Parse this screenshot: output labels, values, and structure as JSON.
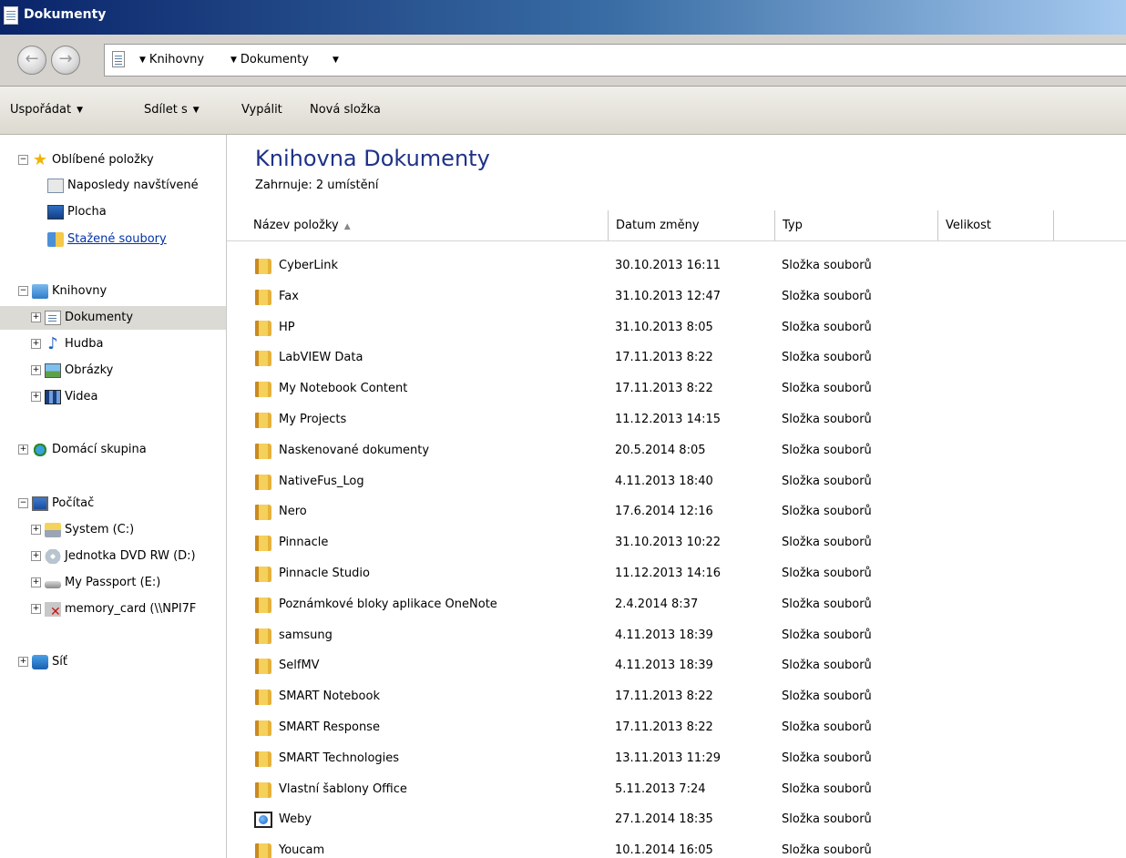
{
  "window": {
    "title": "Dokumenty"
  },
  "address": {
    "crumbs": [
      "Knihovny",
      "Dokumenty"
    ]
  },
  "toolbar": {
    "organize": "Uspořádat",
    "share": "Sdílet s",
    "burn": "Vypálit",
    "new_folder": "Nová složka"
  },
  "nav": {
    "favorites": "Oblíbené položky",
    "recent": "Naposledy navštívené",
    "desktop": "Plocha",
    "downloads": "Stažené soubory",
    "libraries": "Knihovny",
    "documents": "Dokumenty",
    "music": "Hudba",
    "pictures": "Obrázky",
    "videos": "Videa",
    "homegroup": "Domácí skupina",
    "computer": "Počítač",
    "drive_c": "System (C:)",
    "drive_d": "Jednotka DVD RW (D:)",
    "drive_e": "My Passport (E:)",
    "drive_net": "memory_card (\\\\NPI7F",
    "network": "Síť"
  },
  "main": {
    "title": "Knihovna Dokumenty",
    "includes_label": "Zahrnuje:",
    "includes_value": "2 umístění",
    "columns": [
      "Název položky",
      "Datum změny",
      "Typ",
      "Velikost"
    ],
    "rows": [
      {
        "name": "CyberLink",
        "date": "30.10.2013 16:11",
        "type": "Složka souborů",
        "icon": "folder-icon"
      },
      {
        "name": "Fax",
        "date": "31.10.2013 12:47",
        "type": "Složka souborů",
        "icon": "folder-icon"
      },
      {
        "name": "HP",
        "date": "31.10.2013 8:05",
        "type": "Složka souborů",
        "icon": "folder-icon"
      },
      {
        "name": "LabVIEW Data",
        "date": "17.11.2013 8:22",
        "type": "Složka souborů",
        "icon": "folder-icon"
      },
      {
        "name": "My Notebook Content",
        "date": "17.11.2013 8:22",
        "type": "Složka souborů",
        "icon": "folder-icon"
      },
      {
        "name": "My Projects",
        "date": "11.12.2013 14:15",
        "type": "Složka souborů",
        "icon": "folder-icon"
      },
      {
        "name": "Naskenované dokumenty",
        "date": "20.5.2014 8:05",
        "type": "Složka souborů",
        "icon": "folder-icon"
      },
      {
        "name": "NativeFus_Log",
        "date": "4.11.2013 18:40",
        "type": "Složka souborů",
        "icon": "folder-icon"
      },
      {
        "name": "Nero",
        "date": "17.6.2014 12:16",
        "type": "Složka souborů",
        "icon": "folder-icon"
      },
      {
        "name": "Pinnacle",
        "date": "31.10.2013 10:22",
        "type": "Složka souborů",
        "icon": "folder-icon"
      },
      {
        "name": "Pinnacle Studio",
        "date": "11.12.2013 14:16",
        "type": "Složka souborů",
        "icon": "folder-icon"
      },
      {
        "name": "Poznámkové bloky aplikace OneNote",
        "date": "2.4.2014 8:37",
        "type": "Složka souborů",
        "icon": "folder-icon"
      },
      {
        "name": "samsung",
        "date": "4.11.2013 18:39",
        "type": "Složka souborů",
        "icon": "folder-icon"
      },
      {
        "name": "SelfMV",
        "date": "4.11.2013 18:39",
        "type": "Složka souborů",
        "icon": "folder-icon"
      },
      {
        "name": "SMART Notebook",
        "date": "17.11.2013 8:22",
        "type": "Složka souborů",
        "icon": "folder-icon"
      },
      {
        "name": "SMART Response",
        "date": "17.11.2013 8:22",
        "type": "Složka souborů",
        "icon": "folder-icon"
      },
      {
        "name": "SMART Technologies",
        "date": "13.11.2013 11:29",
        "type": "Složka souborů",
        "icon": "folder-icon"
      },
      {
        "name": "Vlastní šablony Office",
        "date": "5.11.2013 7:24",
        "type": "Složka souborů",
        "icon": "folder-icon"
      },
      {
        "name": "Weby",
        "date": "27.1.2014 18:35",
        "type": "Složka souborů",
        "icon": "web-folder-icon"
      },
      {
        "name": "Youcam",
        "date": "10.1.2014 16:05",
        "type": "Složka souborů",
        "icon": "folder-icon"
      }
    ]
  }
}
